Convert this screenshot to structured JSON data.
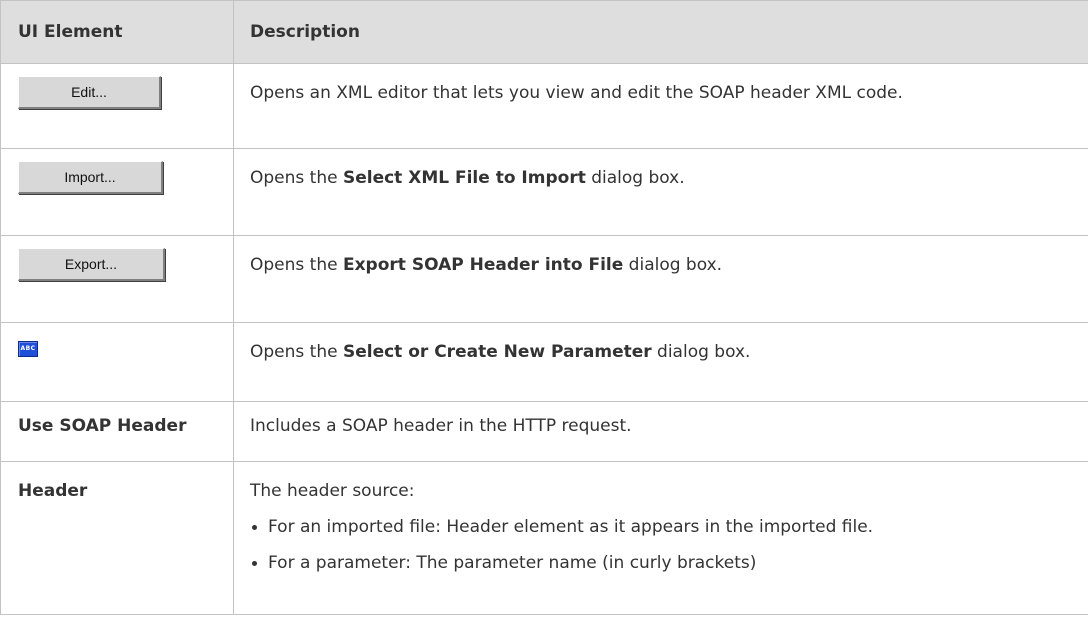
{
  "header": {
    "col1": "UI Element",
    "col2": "Description"
  },
  "rows": [
    {
      "element": "Edit...",
      "desc": "Opens an XML editor that lets you view and edit the SOAP header XML code."
    },
    {
      "element": "Import...",
      "desc_pre": "Opens the ",
      "desc_bold": "Select XML File to Import",
      "desc_post": " dialog box."
    },
    {
      "element": "Export...",
      "desc_pre": "Opens the ",
      "desc_bold": "Export SOAP Header into File",
      "desc_post": " dialog box."
    },
    {
      "icon": "abc-parameter-icon",
      "icon_text": "ABC",
      "desc_pre": "Opens the ",
      "desc_bold": "Select or Create New Parameter",
      "desc_post": " dialog box."
    },
    {
      "element": "Use SOAP Header",
      "desc": "Includes a SOAP header in the HTTP request."
    },
    {
      "element": "Header",
      "desc": "The header source:",
      "bullets": [
        "For an imported file: Header element as it appears in the imported file.",
        "For a parameter: The parameter name (in curly brackets)"
      ]
    }
  ]
}
